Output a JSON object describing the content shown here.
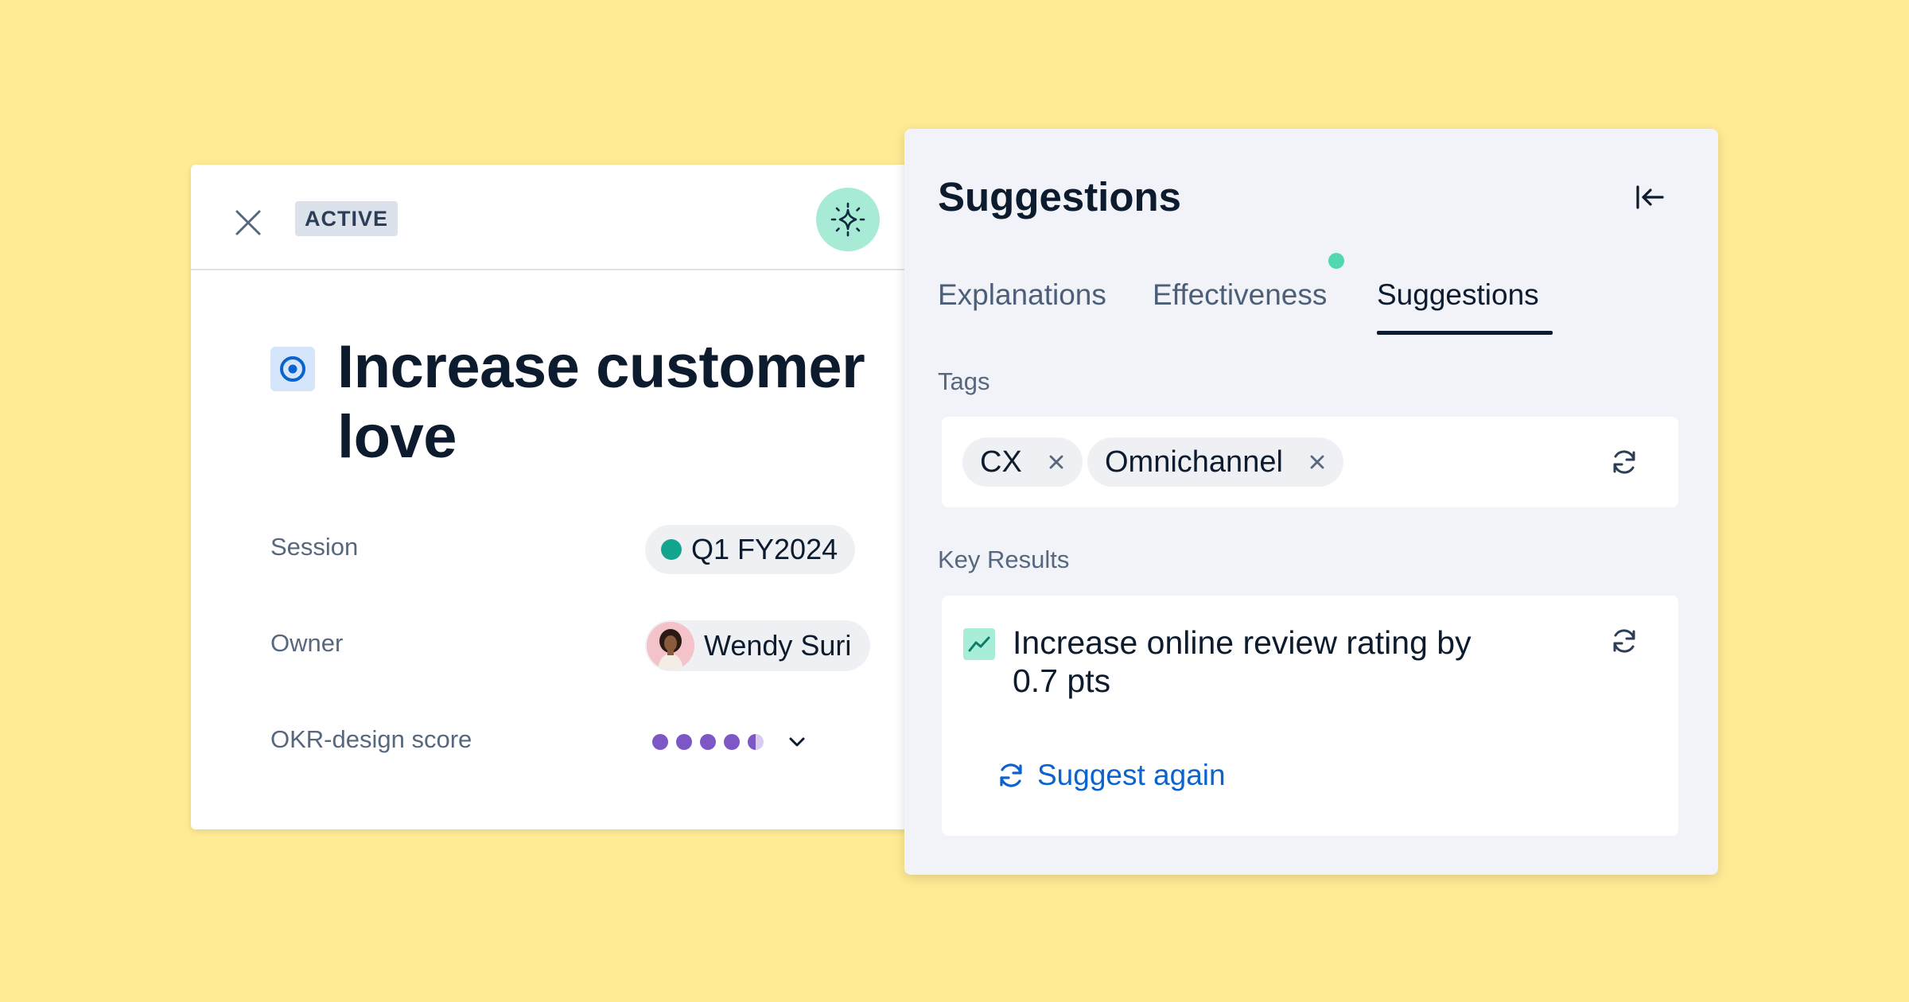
{
  "goal_card": {
    "status_badge": "ACTIVE",
    "title": "Increase customer love",
    "session_label": "Session",
    "session_value": "Q1 FY2024",
    "owner_label": "Owner",
    "owner_name": "Wendy Suri",
    "score_label": "OKR-design score",
    "score_value": 4.5,
    "score_max": 5
  },
  "panel": {
    "title": "Suggestions",
    "tabs": [
      {
        "label": "Explanations",
        "active": false
      },
      {
        "label": "Effectiveness",
        "active": false,
        "notification_dot": true
      },
      {
        "label": "Suggestions",
        "active": true
      }
    ],
    "tags_label": "Tags",
    "tags": [
      "CX",
      "Omnichannel"
    ],
    "key_results_label": "Key Results",
    "key_result": "Increase online review rating by 0.7 pts",
    "suggest_again_label": "Suggest again"
  },
  "colors": {
    "background": "#FFEB94",
    "accent_green": "#14A58E",
    "link_blue": "#0B63CE",
    "score_purple": "#7E57C6"
  },
  "icons": [
    "close-icon",
    "sparkle-icon",
    "target-icon",
    "collapse-left-icon",
    "refresh-icon",
    "trend-up-icon",
    "chevron-down-icon",
    "remove-tag-icon"
  ]
}
